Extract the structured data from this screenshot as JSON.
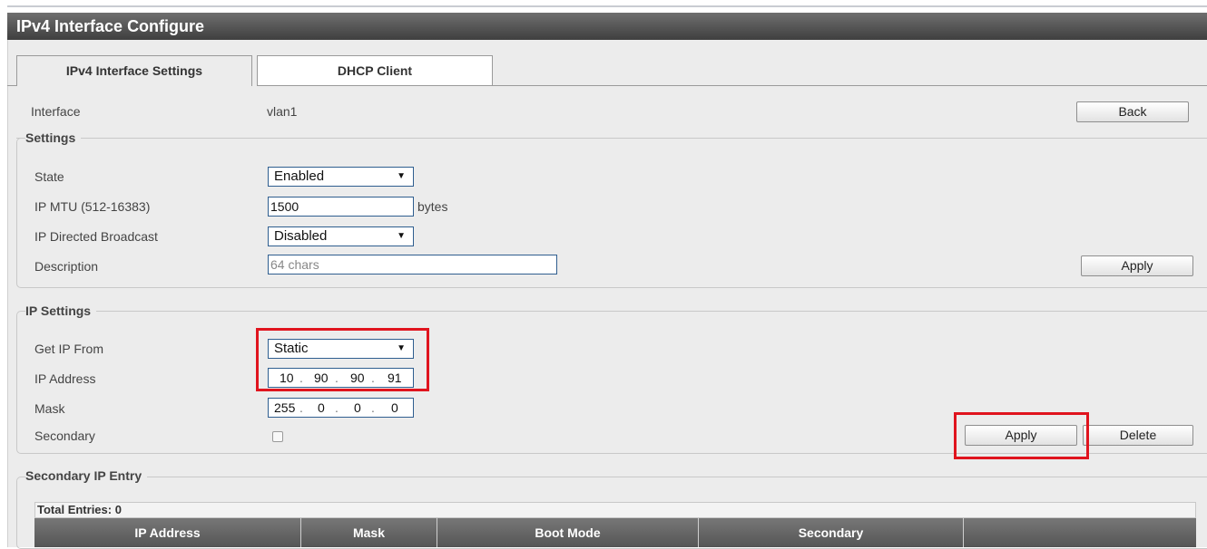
{
  "page": {
    "title": "IPv4 Interface Configure"
  },
  "tabs": [
    {
      "label": "IPv4 Interface Settings"
    },
    {
      "label": "DHCP Client"
    }
  ],
  "interface": {
    "label": "Interface",
    "value": "vlan1",
    "back_label": "Back"
  },
  "settings": {
    "legend": "Settings",
    "state_label": "State",
    "state_value": "Enabled",
    "mtu_label": "IP MTU (512-16383)",
    "mtu_value": "1500",
    "mtu_unit": "bytes",
    "broadcast_label": "IP Directed Broadcast",
    "broadcast_value": "Disabled",
    "description_label": "Description",
    "description_placeholder": "64 chars",
    "apply_label": "Apply"
  },
  "ip_settings": {
    "legend": "IP Settings",
    "get_ip_label": "Get IP From",
    "get_ip_value": "Static",
    "ip_label": "IP Address",
    "ip_octets": [
      "10",
      "90",
      "90",
      "91"
    ],
    "mask_label": "Mask",
    "mask_octets": [
      "255",
      "0",
      "0",
      "0"
    ],
    "secondary_label": "Secondary",
    "secondary_checked": false,
    "apply_label": "Apply",
    "delete_label": "Delete"
  },
  "secondary_entry": {
    "legend": "Secondary IP Entry",
    "total_entries": "Total Entries: 0",
    "columns": [
      "IP Address",
      "Mask",
      "Boot Mode",
      "Secondary",
      ""
    ]
  },
  "colors": {
    "highlight": "#e0141e",
    "title_bar": "#4a4a4a",
    "field_border": "#2f5e8f"
  },
  "icons": {
    "dropdown": "dropdown-arrow-icon",
    "ip_separator": "dot-separator"
  }
}
